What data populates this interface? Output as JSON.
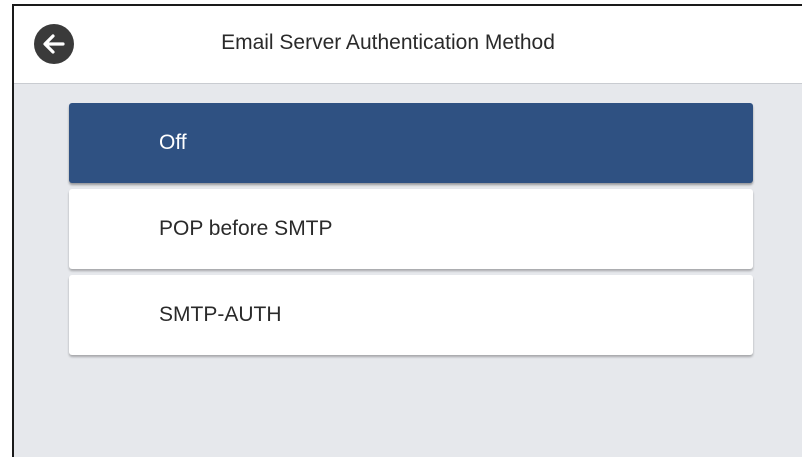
{
  "header": {
    "title": "Email Server Authentication Method",
    "back_icon": "arrow-left-icon"
  },
  "options": [
    {
      "label": "Off",
      "selected": true
    },
    {
      "label": "POP before SMTP",
      "selected": false
    },
    {
      "label": "SMTP-AUTH",
      "selected": false
    }
  ],
  "colors": {
    "selected_bg": "#2f5182",
    "panel_bg": "#e6e8ec",
    "header_bg": "#ffffff"
  }
}
